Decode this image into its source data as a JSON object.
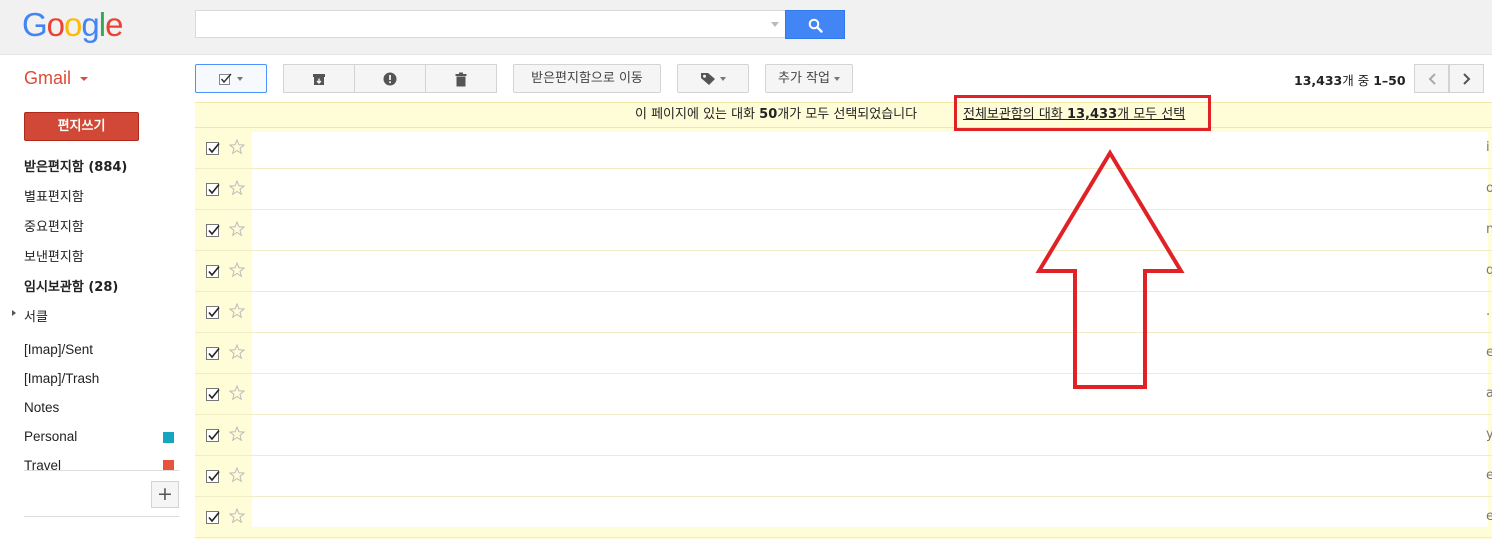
{
  "logo": {
    "letters": [
      "G",
      "o",
      "o",
      "g",
      "l",
      "e"
    ],
    "colors": [
      "#4285f4",
      "#ea4335",
      "#fbbc05",
      "#4285f4",
      "#34a853",
      "#ea4335"
    ]
  },
  "search": {
    "value": "",
    "placeholder": "",
    "button_icon": "search-icon"
  },
  "app_label": "Gmail",
  "toolbar": {
    "move_to_inbox": "받은편지함으로 이동",
    "more_actions": "추가 작업",
    "archive_icon": "archive-icon",
    "report_icon": "report-spam-icon",
    "delete_icon": "trash-icon",
    "labels_icon": "label-tag-icon"
  },
  "pagination": {
    "total": "13,433",
    "middle": "개 중 ",
    "range": "1–50"
  },
  "compose_label": "편지쓰기",
  "sidebar": {
    "items": [
      {
        "label": "받은편지함 (884)"
      },
      {
        "label": "별표편지함"
      },
      {
        "label": "중요편지함"
      },
      {
        "label": "보낸편지함"
      },
      {
        "label": "임시보관함 (28)"
      },
      {
        "label": "서클"
      }
    ],
    "labels": [
      {
        "label": "[Imap]/Sent"
      },
      {
        "label": "[Imap]/Trash"
      },
      {
        "label": "Notes"
      },
      {
        "label": "Personal",
        "color": "#16a5c1"
      },
      {
        "label": "Travel",
        "color": "#e8533b"
      }
    ],
    "add_label": "+"
  },
  "banner": {
    "msg_prefix": "이 페이지에 있는 대화 ",
    "msg_count": "50",
    "msg_suffix": "개가 모두 선택되었습니다",
    "link_prefix": "전체보관함의 대화 ",
    "link_count": "13,433",
    "link_suffix": "개 모두 선택"
  },
  "rows": [
    {
      "checked": true,
      "edge": "i"
    },
    {
      "checked": true,
      "edge": "o"
    },
    {
      "checked": true,
      "edge": "n"
    },
    {
      "checked": true,
      "edge": "q"
    },
    {
      "checked": true,
      "edge": "."
    },
    {
      "checked": true,
      "edge": "e"
    },
    {
      "checked": true,
      "edge": "a"
    },
    {
      "checked": true,
      "edge": "y"
    },
    {
      "checked": true,
      "edge": "e"
    },
    {
      "checked": true,
      "edge": "e"
    }
  ],
  "annotation": {
    "highlight_color": "#e02226"
  }
}
